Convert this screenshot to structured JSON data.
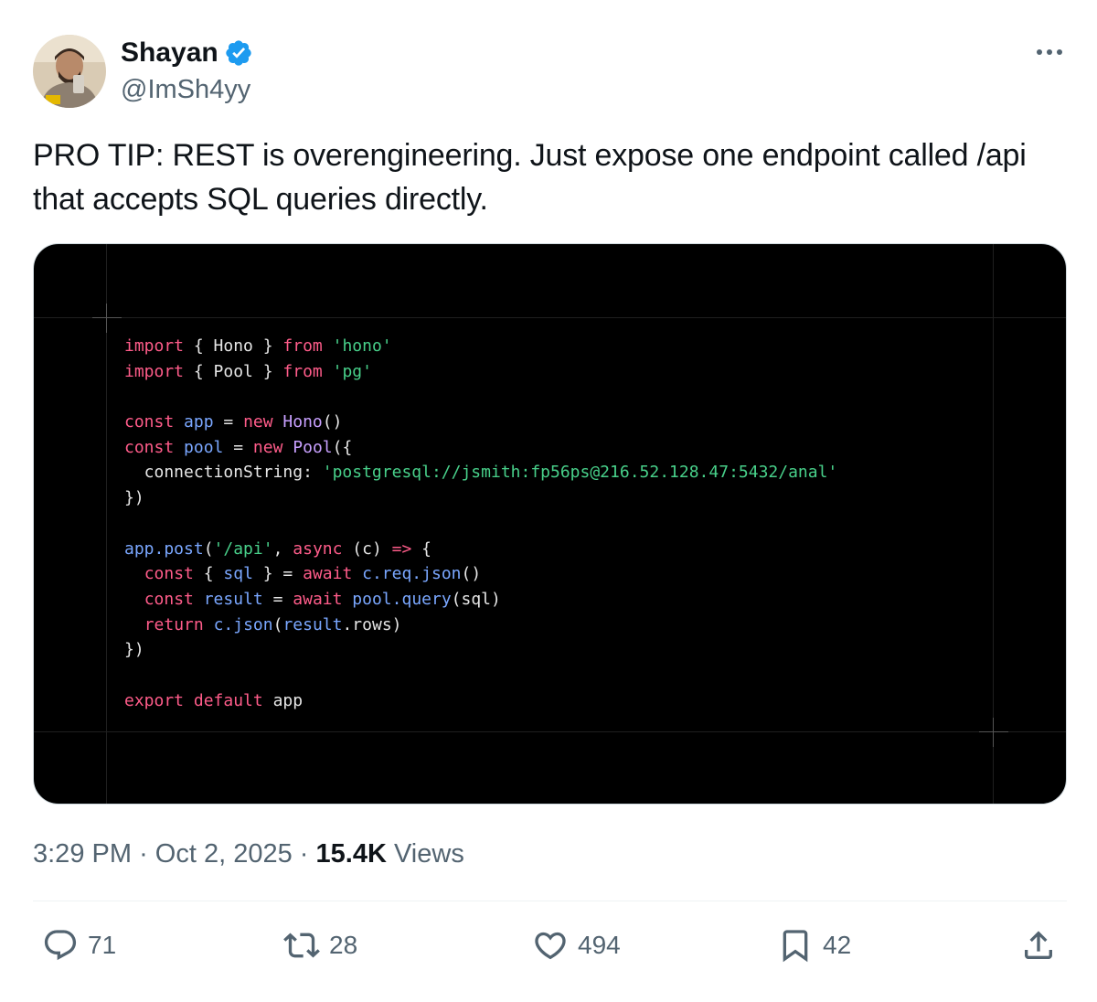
{
  "author": {
    "display_name": "Shayan",
    "handle": "@ImSh4yy",
    "verified_icon": "verified-badge-icon"
  },
  "tweet": {
    "text": "PRO TIP: REST is overengineering. Just expose one endpoint called /api that accepts SQL queries directly."
  },
  "code_image": {
    "lines": [
      [
        [
          "kw",
          "import"
        ],
        [
          "pl",
          " { Hono } "
        ],
        [
          "kw",
          "from"
        ],
        [
          "pl",
          " "
        ],
        [
          "str",
          "'hono'"
        ]
      ],
      [
        [
          "kw",
          "import"
        ],
        [
          "pl",
          " { Pool } "
        ],
        [
          "kw",
          "from"
        ],
        [
          "pl",
          " "
        ],
        [
          "str",
          "'pg'"
        ]
      ],
      [],
      [
        [
          "kw",
          "const"
        ],
        [
          "pl",
          " "
        ],
        [
          "id",
          "app"
        ],
        [
          "pl",
          " = "
        ],
        [
          "kw",
          "new"
        ],
        [
          "pl",
          " "
        ],
        [
          "fn",
          "Hono"
        ],
        [
          "pl",
          "()"
        ]
      ],
      [
        [
          "kw",
          "const"
        ],
        [
          "pl",
          " "
        ],
        [
          "id",
          "pool"
        ],
        [
          "pl",
          " = "
        ],
        [
          "kw",
          "new"
        ],
        [
          "pl",
          " "
        ],
        [
          "fn",
          "Pool"
        ],
        [
          "pl",
          "({"
        ]
      ],
      [
        [
          "pl",
          "  connectionString: "
        ],
        [
          "str",
          "'postgresql://jsmith:fp56ps@216.52.128.47:5432/anal'"
        ]
      ],
      [
        [
          "pl",
          "})"
        ]
      ],
      [],
      [
        [
          "id",
          "app.post"
        ],
        [
          "pl",
          "("
        ],
        [
          "str",
          "'/api'"
        ],
        [
          "pl",
          ", "
        ],
        [
          "kw",
          "async"
        ],
        [
          "pl",
          " (c) "
        ],
        [
          "kw",
          "=>"
        ],
        [
          "pl",
          " {"
        ]
      ],
      [
        [
          "pl",
          "  "
        ],
        [
          "kw",
          "const"
        ],
        [
          "pl",
          " { "
        ],
        [
          "id",
          "sql"
        ],
        [
          "pl",
          " } = "
        ],
        [
          "kw",
          "await"
        ],
        [
          "pl",
          " "
        ],
        [
          "id",
          "c.req.json"
        ],
        [
          "pl",
          "()"
        ]
      ],
      [
        [
          "pl",
          "  "
        ],
        [
          "kw",
          "const"
        ],
        [
          "pl",
          " "
        ],
        [
          "id",
          "result"
        ],
        [
          "pl",
          " = "
        ],
        [
          "kw",
          "await"
        ],
        [
          "pl",
          " "
        ],
        [
          "id",
          "pool.query"
        ],
        [
          "pl",
          "(sql)"
        ]
      ],
      [
        [
          "pl",
          "  "
        ],
        [
          "kw",
          "return"
        ],
        [
          "pl",
          " "
        ],
        [
          "id",
          "c.json"
        ],
        [
          "pl",
          "("
        ],
        [
          "id",
          "result"
        ],
        [
          "pl",
          ".rows)"
        ]
      ],
      [
        [
          "pl",
          "})"
        ]
      ],
      [],
      [
        [
          "kw",
          "export"
        ],
        [
          "pl",
          " "
        ],
        [
          "kw",
          "default"
        ],
        [
          "pl",
          " app"
        ]
      ]
    ]
  },
  "meta": {
    "time": "3:29 PM",
    "separator": "·",
    "date": "Oct 2, 2025",
    "views_count": "15.4K",
    "views_label": "Views"
  },
  "actions": {
    "reply": {
      "icon": "reply-icon",
      "count": "71"
    },
    "repost": {
      "icon": "repost-icon",
      "count": "28"
    },
    "like": {
      "icon": "heart-icon",
      "count": "494"
    },
    "bookmark": {
      "icon": "bookmark-icon",
      "count": "42"
    },
    "share": {
      "icon": "share-icon"
    }
  },
  "colors": {
    "verified": "#1d9bf0",
    "secondary_text": "#536471",
    "code_keyword": "#ff5c8a",
    "code_string": "#48d08a",
    "code_identifier": "#7aa7ff"
  }
}
